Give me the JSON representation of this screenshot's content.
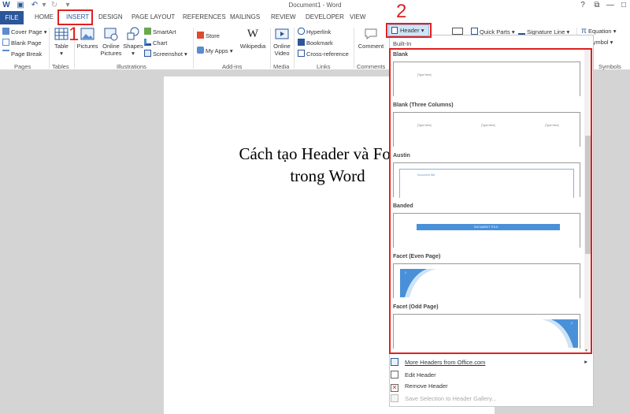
{
  "window": {
    "title": "Document1 - Word",
    "help": "?",
    "restore": "⧉",
    "minimize": "—",
    "maximize": "□",
    "close": "✕"
  },
  "tabs": [
    "FILE",
    "HOME",
    "INSERT",
    "DESIGN",
    "PAGE LAYOUT",
    "REFERENCES",
    "MAILINGS",
    "REVIEW",
    "DEVELOPER",
    "VIEW"
  ],
  "ribbon": {
    "pages": {
      "cover_page": "Cover Page",
      "blank_page": "Blank Page",
      "page_break": "Page Break",
      "label": "Pages"
    },
    "tables": {
      "table": "Table",
      "label": "Tables"
    },
    "illustrations": {
      "pictures": "Pictures",
      "online_pictures_1": "Online",
      "online_pictures_2": "Pictures",
      "shapes": "Shapes",
      "smartart": "SmartArt",
      "chart": "Chart",
      "screenshot": "Screenshot",
      "label": "Illustrations"
    },
    "addins": {
      "store": "Store",
      "my_apps": "My Apps",
      "wikipedia": "Wikipedia",
      "label": "Add-ins"
    },
    "media": {
      "online_video_1": "Online",
      "online_video_2": "Video",
      "label": "Media"
    },
    "links": {
      "hyperlink": "Hyperlink",
      "bookmark": "Bookmark",
      "cross_reference": "Cross-reference",
      "label": "Links"
    },
    "comments": {
      "comment": "Comment",
      "label": "Comments"
    },
    "header_footer": {
      "header": "Header"
    },
    "text": {
      "quick_parts": "Quick Parts",
      "signature_line": "Signature Line"
    },
    "symbols": {
      "equation": "Equation",
      "symbol": "Symbol",
      "label": "Symbols"
    }
  },
  "document": {
    "title_line1": "Cách tạo Header và Footer",
    "title_line2": "trong Word"
  },
  "gallery": {
    "builtin_label": "Built-In",
    "sections": [
      {
        "name": "Blank",
        "placeholders": [
          "[Type here]"
        ]
      },
      {
        "name": "Blank (Three Columns)",
        "placeholders": [
          "[Type here]",
          "[Type here]",
          "[Type here]"
        ]
      },
      {
        "name": "Austin",
        "placeholders": [
          "Document title"
        ]
      },
      {
        "name": "Banded",
        "placeholders": [
          "DOCUMENT TITLE"
        ]
      },
      {
        "name": "Facet (Even Page)",
        "placeholders": [
          "1"
        ]
      },
      {
        "name": "Facet (Odd Page)",
        "placeholders": [
          "1"
        ]
      }
    ],
    "menu": [
      {
        "label": "More Headers from Office.com",
        "disabled": false
      },
      {
        "label": "Edit Header",
        "disabled": false
      },
      {
        "label": "Remove Header",
        "disabled": false
      },
      {
        "label": "Save Selection to Header Gallery...",
        "disabled": true
      }
    ]
  },
  "annotations": {
    "step1": "1",
    "step2": "2"
  },
  "colors": {
    "accent": "#2b579a",
    "highlight": "#e02020",
    "banded": "#4a90d9"
  }
}
